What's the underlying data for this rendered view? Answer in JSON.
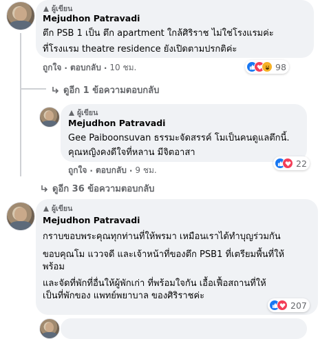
{
  "comments": [
    {
      "author_badge": "ผู้เขียน",
      "name": "Mejudhon Patravadi",
      "lines": [
        "ตึก PSB 1 เป็น ตึก apartment ใกล้ศิริราช ไม่ใช่โรงแรมค่ะ",
        "ที่โรงแรม theatre residence ยังเปิดตามปรกติค่ะ"
      ],
      "like": "ถูกใจ",
      "reply": "ตอบกลับ",
      "time": "10 ชม.",
      "reaction_count": "98",
      "reactions": [
        "like-icon",
        "love-icon",
        "haha-icon"
      ],
      "more_replies": "ดูอีก 1 ข้อความตอบกลับ"
    },
    {
      "author_badge": "ผู้เขียน",
      "name": "Mejudhon Patravadi",
      "lines": [
        "Gee Paiboonsuvan ธรรมะจัดสรรค์ โมเป็นคนดูแลตึกนี้.",
        "คุณหญิงคงดีใจที่หลาน มีจิตอาสา"
      ],
      "like": "ถูกใจ",
      "reply": "ตอบกลับ",
      "time": "9 ชม.",
      "reaction_count": "22",
      "reactions": [
        "like-icon",
        "love-icon"
      ],
      "more_replies": "ดูอีก 36 ข้อความตอบกลับ"
    },
    {
      "author_badge": "ผู้เขียน",
      "name": "Mejudhon Patravadi",
      "lines": [
        "กราบขอบพระคุณทุกท่านที่ให้พรมา เหมือนเราได้ทำบุญร่วมกัน",
        "ขอบคุณโม แววจดี และเจ้าหน้าที่ของตึก PSB1 ที่เตรียมพื้นที่ให้",
        "พร้อม",
        "และจัดที่พักที่อื่นให้ผู้พักเก่า ที่พร้อมใจกัน เอื้อเฟื้อสถานที่ให้",
        "เป็นที่พักของ แพทย์พยาบาล ของศิริราชค่ะ"
      ],
      "reaction_count": "207",
      "reactions": [
        "like-icon",
        "love-icon"
      ]
    }
  ],
  "colors": {
    "bubble": "#f0f2f5",
    "like": "#1877f2",
    "love": "#f33e58",
    "haha": "#f7b125",
    "muted": "#65676b"
  }
}
